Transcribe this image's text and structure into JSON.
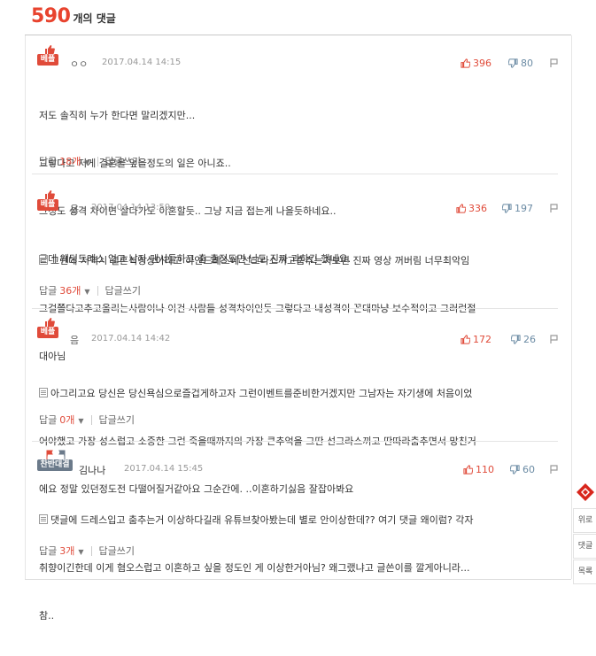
{
  "header": {
    "count": "590",
    "suffix": "개의 댓글"
  },
  "comments": [
    {
      "badge": "베플",
      "name": "ㅇㅇ",
      "date": "2017.04.14 14:15",
      "up": "396",
      "down": "80",
      "lines": [
        "저도 솔직히 누가 한다면 말리겠지만...",
        "그렇다고 저게 결혼을 엎을정도의 일은 아니죠..",
        "그정도 성격 차이면 살다가도 이혼할듯.. 그냥 지금 접는게 나을듯하네요..",
        "근데 웨딩드레스 입고 남자 댄서들하고 춤 출정도면 님도 진짜 과하긴 했네요."
      ],
      "reply_label": "답글",
      "reply_count": "18개",
      "write_label": "답글쓰기"
    },
    {
      "badge": "베플",
      "name": "음",
      "date": "2017.04.14 13:59",
      "up": "336",
      "down": "197",
      "lines": [
        "그런데 저역시 결혼식영상이라고 하얀드레스에 선그라스끼고춤추는거보면 진짜 영상 꺼버림 너무최악임",
        "그걸쭐다고추고올리는사람이나 이건 사람들 성격차이인듯 그렇다고 내성격이 꼰대마냥 보수적이고 그러런절",
        "대아님"
      ],
      "reply_label": "답글",
      "reply_count": "36개",
      "write_label": "답글쓰기"
    },
    {
      "badge": "베플",
      "name": "음",
      "date": "2017.04.14 14:42",
      "up": "172",
      "down": "26",
      "lines": [
        "아그리고요 당신은 당신욕심으로즐겁게하고자 그런이벤트를준비한거겠지만 그남자는 자기생에 처음이었",
        "어야했고 가장 성스럽고 소중한 그런 죽을때까지의 가장 큰추억을 그딴 선그라스끼고 딴따라춤추면서 망친거",
        "에요 정말 있던정도전 다떨어질거같아요 그순간에. ..이혼하기싫음 잘잡아봐요"
      ],
      "reply_label": "답글",
      "reply_count": "0개",
      "write_label": "답글쓰기"
    },
    {
      "badge": "찬반대결",
      "name": "김나나",
      "date": "2017.04.14 15:45",
      "up": "110",
      "down": "60",
      "lines": [
        "댓글에 드레스입고 춤추는거 이상하다길래 유튜브찾아봤는데 별로 안이상한데?? 여기 댓글 왜이럼? 각자",
        "취향이긴한데 이게 혐오스럽고 이혼하고 싶을 정도인 게 이상한거아님? 왜그랬냐고 글쓴이를 깔게아니라...",
        "참.."
      ],
      "reply_label": "답글",
      "reply_count": "3개",
      "write_label": "답글쓰기"
    }
  ],
  "side": {
    "up_label": "위로",
    "comment_label": "댓글",
    "list_label": "목록"
  },
  "colors": {
    "accent": "#e8432e",
    "badge": "#e04b3a",
    "down": "#6b8ba4"
  }
}
